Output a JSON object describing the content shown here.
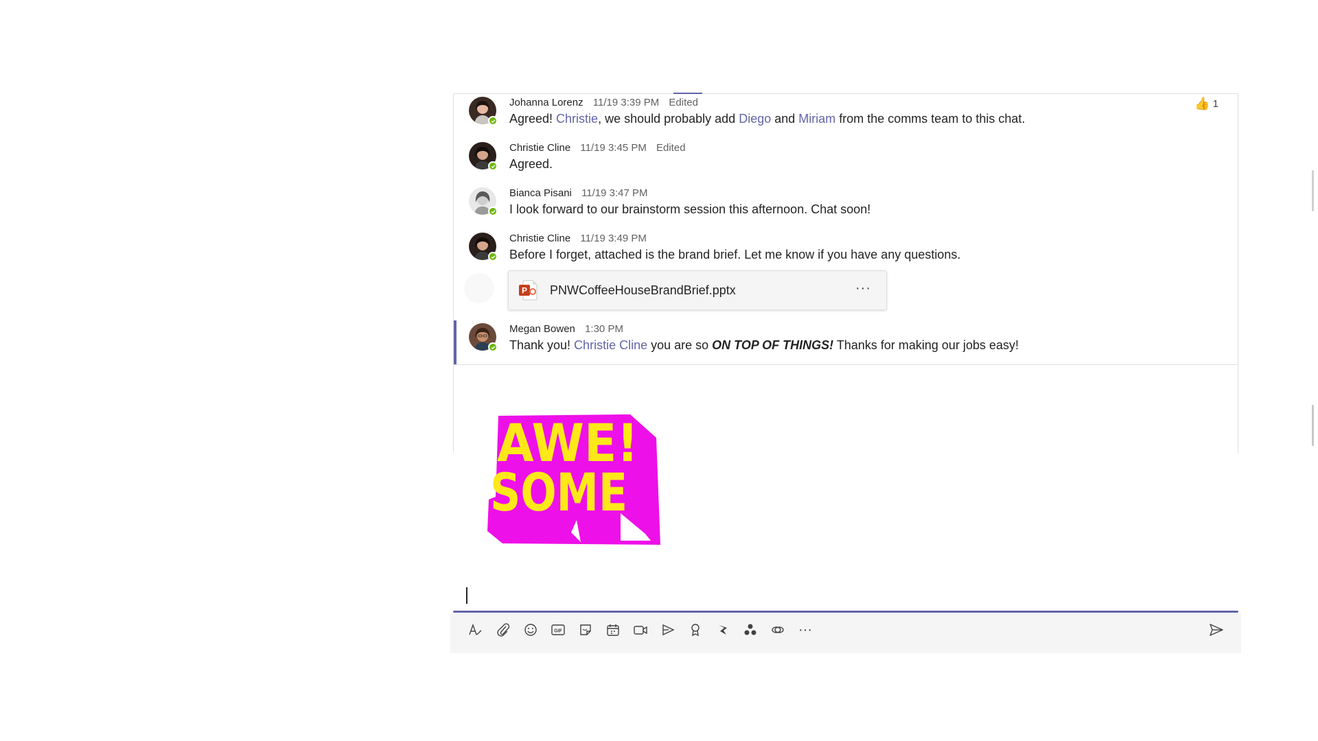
{
  "messages": [
    {
      "author": "Johanna Lorenz",
      "time": "11/19 3:39 PM",
      "edited": "Edited",
      "body": {
        "t1": "Agreed! ",
        "m1": "Christie",
        "t2": ", we should probably add ",
        "m2": "Diego",
        "t3": " and ",
        "m3": "Miriam",
        "t4": " from the comms team to this chat."
      },
      "reaction": {
        "emoji": "👍",
        "count": "1"
      }
    },
    {
      "author": "Christie Cline",
      "time": "11/19 3:45 PM",
      "edited": "Edited",
      "body": {
        "text": "Agreed."
      }
    },
    {
      "author": "Bianca Pisani",
      "time": "11/19 3:47 PM",
      "body": {
        "text": "I look forward to our brainstorm session this afternoon. Chat soon!"
      }
    },
    {
      "author": "Christie Cline",
      "time": "11/19 3:49 PM",
      "body": {
        "text": "Before I forget, attached is the brand brief. Let me know if you have any questions."
      },
      "attachment": {
        "filename": "PNWCoffeeHouseBrandBrief.pptx",
        "more": "···",
        "icon": "powerpoint-file-icon"
      }
    },
    {
      "author": "Megan Bowen",
      "time": "1:30 PM",
      "body": {
        "t1": "Thank you! ",
        "m1": "Christie Cline",
        "t2": " you are so ",
        "b1": "ON TOP OF THINGS!",
        "t3": " Thanks for making our jobs easy!"
      }
    }
  ],
  "sticker": {
    "line1": "AWE!",
    "line2": "SOME",
    "colors": {
      "text": "#ffe81a",
      "shadow": "#ee10e8"
    }
  },
  "compose": {
    "toolbar_icons": [
      "format-icon",
      "attach-icon",
      "emoji-icon",
      "gif-icon",
      "sticker-icon",
      "meet-icon",
      "video-icon",
      "stream-icon",
      "praise-icon",
      "flow-icon",
      "apps-icon",
      "loop-icon",
      "more-options-icon"
    ],
    "more_label": "···",
    "send_icon": "send-icon"
  },
  "colors": {
    "accent": "#6264a7",
    "presence": "#6bb700",
    "ppt": "#c43e1c"
  }
}
